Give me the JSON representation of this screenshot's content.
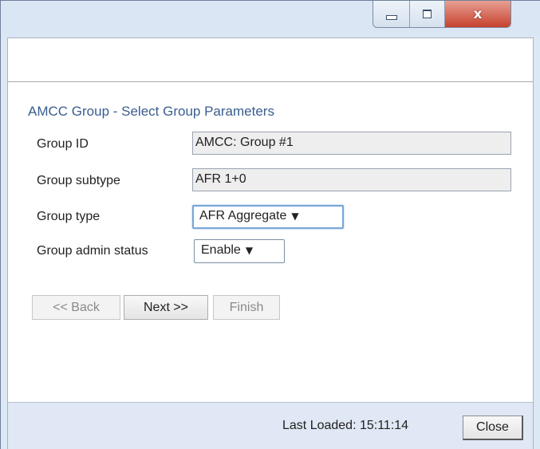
{
  "window": {
    "controls": {
      "minimize_icon": "minimize-icon",
      "maximize_icon": "maximize-icon",
      "close_icon": "close-icon",
      "close_glyph": "x"
    }
  },
  "form": {
    "heading": "AMCC Group - Select Group Parameters",
    "fields": [
      {
        "label": "Group ID",
        "value": "AMCC: Group #1"
      },
      {
        "label": "Group subtype",
        "value": "AFR 1+0"
      }
    ],
    "group_type": {
      "label": "Group type",
      "selected": "AFR Aggregate"
    },
    "admin_status": {
      "label": "Group admin status",
      "selected": "Enable"
    }
  },
  "buttons": {
    "back": "<< Back",
    "next": "Next >>",
    "finish": "Finish"
  },
  "footer": {
    "last_loaded": "Last Loaded: 15:11:14",
    "close": "Close"
  },
  "colors": {
    "heading": "#3a5d8f",
    "footer_bg": "#dfe8f4",
    "close_control": "#c6412e"
  }
}
